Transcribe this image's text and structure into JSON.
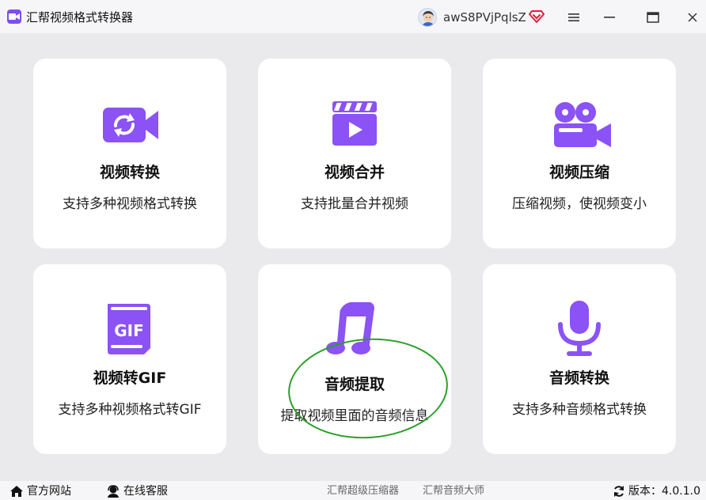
{
  "app": {
    "title": "汇帮视频格式转换器",
    "username": "awS8PVjPqlsZ"
  },
  "colors": {
    "accent": "#8b52f5",
    "background": "#eaeaed",
    "card": "#ffffff",
    "annotation": "#2aa02a",
    "vip": "#e0203c"
  },
  "cards": [
    {
      "title": "视频转换",
      "desc": "支持多种视频格式转换",
      "icon": "video-convert-icon"
    },
    {
      "title": "视频合并",
      "desc": "支持批量合并视频",
      "icon": "clapperboard-icon"
    },
    {
      "title": "视频压缩",
      "desc": "压缩视频，使视频变小",
      "icon": "video-camera-icon"
    },
    {
      "title": "视频转GIF",
      "desc": "支持多种视频格式转GIF",
      "icon": "gif-file-icon"
    },
    {
      "title": "音频提取",
      "desc": "提取视频里面的音频信息",
      "icon": "music-note-icon"
    },
    {
      "title": "音频转换",
      "desc": "支持多种音频格式转换",
      "icon": "microphone-icon"
    }
  ],
  "footer": {
    "site": "官方网站",
    "service": "在线客服",
    "product1": "汇帮超级压缩器",
    "product2": "汇帮音频大师",
    "version": "版本：4.0.1.0"
  }
}
